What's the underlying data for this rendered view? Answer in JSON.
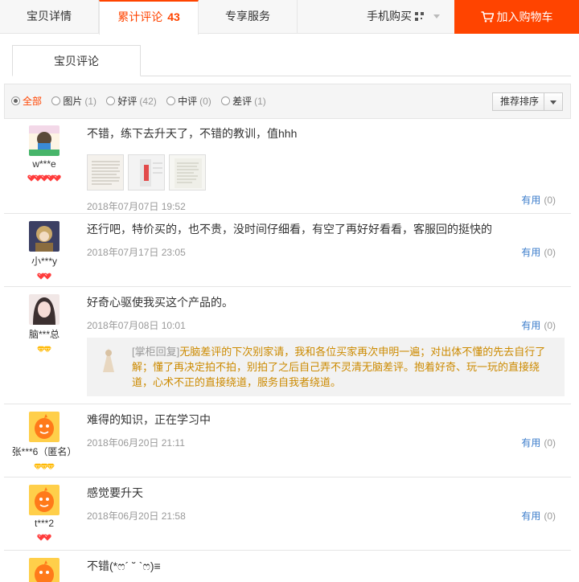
{
  "tabs": {
    "detail": "宝贝详情",
    "reviews": "累计评论",
    "reviews_count": "43",
    "service": "专享服务",
    "phone_buy": "手机购买",
    "add_cart": "加入购物车"
  },
  "inner_tab": "宝贝评论",
  "filters": [
    {
      "label": "全部",
      "count": "",
      "selected": true
    },
    {
      "label": "图片",
      "count": "(1)",
      "selected": false
    },
    {
      "label": "好评",
      "count": "(42)",
      "selected": false
    },
    {
      "label": "中评",
      "count": "(0)",
      "selected": false
    },
    {
      "label": "差评",
      "count": "(1)",
      "selected": false
    }
  ],
  "sort_label": "推荐排序",
  "useful_label": "有用",
  "reviews": [
    {
      "user": "w***e",
      "text": "不错，练下去升天了，不错的教训，值hhh",
      "date": "2018年07月07日 19:52",
      "useful": "(0)"
    },
    {
      "user": "小***y",
      "text": "还行吧，特价买的，也不贵，没时间仔细看，有空了再好好看看，客服回的挺快的",
      "date": "2018年07月17日 23:05",
      "useful": "(0)"
    },
    {
      "user": "脑***总",
      "text": "好奇心驱使我买这个产品的。",
      "date": "2018年07月08日 10:01",
      "useful": "(0)",
      "reply": {
        "tag": "[掌柜回复]",
        "text": "无脑差评的下次别家请，我和各位买家再次申明一遍；对出体不懂的先去自行了解；懂了再决定拍不拍，别拍了之后自己弄不灵清无脑差评。抱着好奇、玩一玩的直接绕道，心术不正的直接绕道，服务自我者绕道。"
      }
    },
    {
      "user": "张***6（匿名）",
      "text": "难得的知识，正在学习中",
      "date": "2018年06月20日 21:11",
      "useful": "(0)"
    },
    {
      "user": "t***2",
      "text": "感觉要升天",
      "date": "2018年06月20日 21:58",
      "useful": "(0)"
    },
    {
      "user": "",
      "text": "不错(*ෆ´ ˘ `ෆ)≡",
      "date": "",
      "useful": ""
    }
  ]
}
